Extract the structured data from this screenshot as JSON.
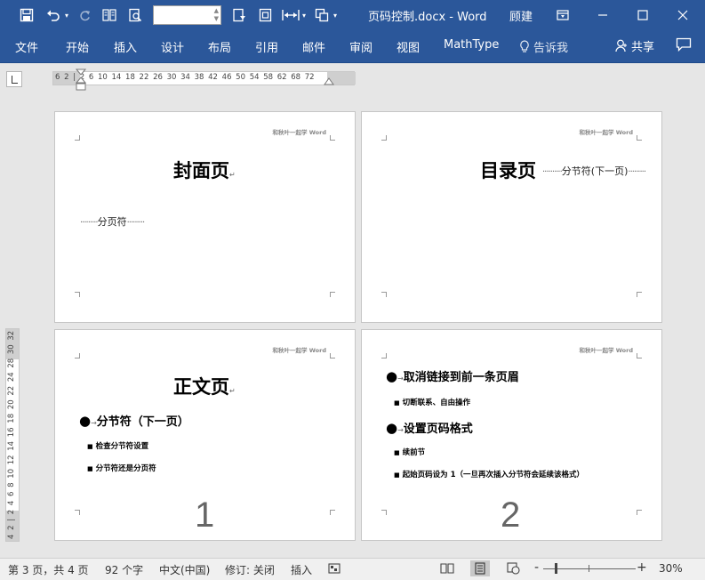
{
  "titlebar": {
    "doc_title": "页码控制.docx  -  Word",
    "username": "顾建",
    "name_box_value": "",
    "icons": [
      "save-icon",
      "undo-icon",
      "redo-icon",
      "columns-icon",
      "print-preview-icon",
      "page-setup-icon",
      "frame-icon",
      "indent-icon",
      "copy-format-icon",
      "ribbon-display-icon",
      "minimize-icon",
      "maximize-icon",
      "close-icon"
    ]
  },
  "menu": {
    "items": [
      "文件",
      "开始",
      "插入",
      "设计",
      "布局",
      "引用",
      "邮件",
      "审阅",
      "视图",
      "MathType"
    ],
    "tell_me": "告诉我",
    "share": "共享"
  },
  "ruler": {
    "h_numbers": "6  2   |   2   6  10  14  18  22  26  30  34  38  42  46  50  54  58  62   68  72",
    "v_numbers": "4  2   |   2  4  6  8  10 12 14 16 18 20 22 24   28 30 32"
  },
  "pages": [
    {
      "header": "和秋叶一起学 Word",
      "title": "封面页",
      "mark": "↵",
      "break_dots_left": "·········",
      "break_label": "分页符",
      "break_dots_right": "·········"
    },
    {
      "header": "和秋叶一起学 Word",
      "title": "目录页",
      "break_dots_left": "··········",
      "break_label": "分节符(下一页)",
      "break_dots_right": "·········"
    },
    {
      "header": "和秋叶一起学 Word",
      "title": "正文页",
      "mark": "↵",
      "l1": "分节符（下一页）",
      "l2a": "检查分节符设置",
      "l2b": "分节符还是分页符",
      "page_number": "1"
    },
    {
      "header": "和秋叶一起学 Word",
      "l1a": "取消链接到前一条页眉",
      "l2a": "切断联系、自由操作",
      "l1b": "设置页码格式",
      "l2b": "续前节",
      "l2c": "起始页码设为 1（一旦再次插入分节符会延续该格式）",
      "page_number": "2"
    }
  ],
  "status": {
    "page_info": "第 3 页，共 4 页",
    "word_count": "92 个字",
    "language": "中文(中国)",
    "revisions": "修订: 关闭",
    "insert_mode": "插入",
    "zoom_minus": "-",
    "zoom_plus": "+",
    "zoom_level": "30%"
  },
  "colors": {
    "titlebar": "#2b579a",
    "workspace": "#e6e6e6",
    "statusbar": "#f0f0f0"
  }
}
